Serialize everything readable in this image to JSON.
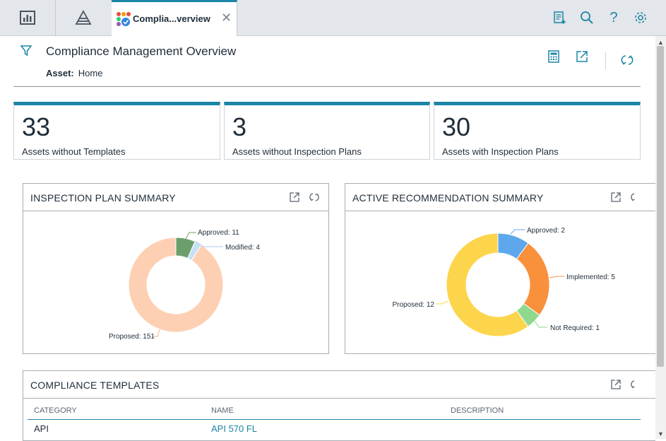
{
  "tabs": {
    "active_title": "Complia...verview"
  },
  "header": {
    "title": "Compliance Management Overview",
    "asset_label": "Asset:",
    "asset_value": "Home"
  },
  "kpis": [
    {
      "value": "33",
      "label": "Assets without Templates"
    },
    {
      "value": "3",
      "label": "Assets without Inspection Plans"
    },
    {
      "value": "30",
      "label": "Assets with Inspection Plans"
    }
  ],
  "inspection_plan_summary": {
    "title": "INSPECTION PLAN SUMMARY",
    "labels": [
      "Approved: 11",
      "Modified: 4",
      "Proposed: 151"
    ]
  },
  "active_recommendation_summary": {
    "title": "ACTIVE RECOMMENDATION SUMMARY",
    "labels": [
      "Approved: 2",
      "Implemented: 5",
      "Not Required: 1",
      "Proposed: 12"
    ]
  },
  "chart_data": [
    {
      "type": "pie",
      "title": "INSPECTION PLAN SUMMARY",
      "categories": [
        "Approved",
        "Modified",
        "Proposed"
      ],
      "values": [
        11,
        4,
        151
      ],
      "colors": [
        "#6b9e6b",
        "#c6e0f5",
        "#fdd0b3"
      ]
    },
    {
      "type": "pie",
      "title": "ACTIVE RECOMMENDATION SUMMARY",
      "categories": [
        "Approved",
        "Implemented",
        "Not Required",
        "Proposed"
      ],
      "values": [
        2,
        5,
        1,
        12
      ],
      "colors": [
        "#5ea7ec",
        "#f9903c",
        "#8fd98f",
        "#fdd54d"
      ]
    }
  ],
  "compliance_templates": {
    "title": "COMPLIANCE TEMPLATES",
    "columns": [
      "CATEGORY",
      "NAME",
      "DESCRIPTION"
    ],
    "rows": [
      {
        "category": "API",
        "name": "API 570 FL",
        "description": ""
      }
    ]
  },
  "icons": {
    "tab1": "dashboard-icon",
    "tab2": "pyramid-icon",
    "search": "search-icon",
    "help": "help-icon",
    "settings": "gear-icon",
    "filter": "filter-icon"
  },
  "colors": {
    "accent": "#1b85a6",
    "link": "#1b85a6"
  }
}
